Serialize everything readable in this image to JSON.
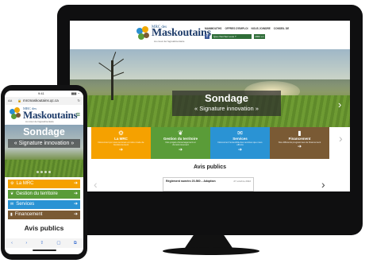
{
  "site": {
    "brand_prefix": "MRC des",
    "brand_name": "Maskoutains",
    "tagline": "Au cœur de l'agroalimentaire",
    "url": "mrcmaskoutains.qc.ca"
  },
  "colors": {
    "mrc": "#f5a100",
    "territoire": "#5a9c38",
    "services": "#2a93d4",
    "financement": "#7a5a34",
    "brand_green": "#2f6d38"
  },
  "desktop": {
    "nav": [
      "MAMMOUTHS",
      "OFFRES D'EMPLOI",
      "NOUS JOINDRE",
      "CONSEIL DE"
    ],
    "search_placeholder": "Que cherchez-vous ?",
    "util_button": "MRC en",
    "hero": {
      "title": "Sondage",
      "subtitle": "« Signature innovation »"
    },
    "tiles": [
      {
        "icon": "gear-icon",
        "glyph": "⚙",
        "title": "La MRC",
        "desc": "Découvrez qui nous sommes et notre mode de fonctionnement",
        "arrow": "➔"
      },
      {
        "icon": "leaf-icon",
        "glyph": "❦",
        "title": "Gestion du territoire",
        "desc": "Nos projets d'aménagement et d'environnement",
        "arrow": "➔"
      },
      {
        "icon": "service-icon",
        "glyph": "✉",
        "title": "Services",
        "desc": "Découvrez l'ensemble des services que nous offrons",
        "arrow": "➔"
      },
      {
        "icon": "chart-icon",
        "glyph": "▮",
        "title": "Financement",
        "desc": "Nos différents programmes de financement",
        "arrow": "➔"
      }
    ],
    "avis_title": "Avis publics",
    "avis_item": {
      "name": "Règlement numéro 20-560 – Adoption",
      "date": "27 octobre 2022"
    }
  },
  "mobile": {
    "status": {
      "time": "9:41",
      "signal": "▮▮▮ ◔"
    },
    "url_bar": {
      "text_size": "AA",
      "lock": "🔒",
      "reload": "↻"
    },
    "menu_glyph": "≡",
    "hero": {
      "title": "Sondage",
      "subtitle": "« Signature innovation »"
    },
    "items": [
      {
        "label": "La MRC",
        "glyph": "⚙",
        "arrow": "➔"
      },
      {
        "label": "Gestion du territoire",
        "glyph": "❦",
        "arrow": "➔"
      },
      {
        "label": "Services",
        "glyph": "✉",
        "arrow": "➔"
      },
      {
        "label": "Financement",
        "glyph": "▮",
        "arrow": "➔"
      }
    ],
    "avis_title": "Avis publics",
    "toolbar": [
      "‹",
      "›",
      "⇪",
      "▢",
      "⧉"
    ]
  }
}
